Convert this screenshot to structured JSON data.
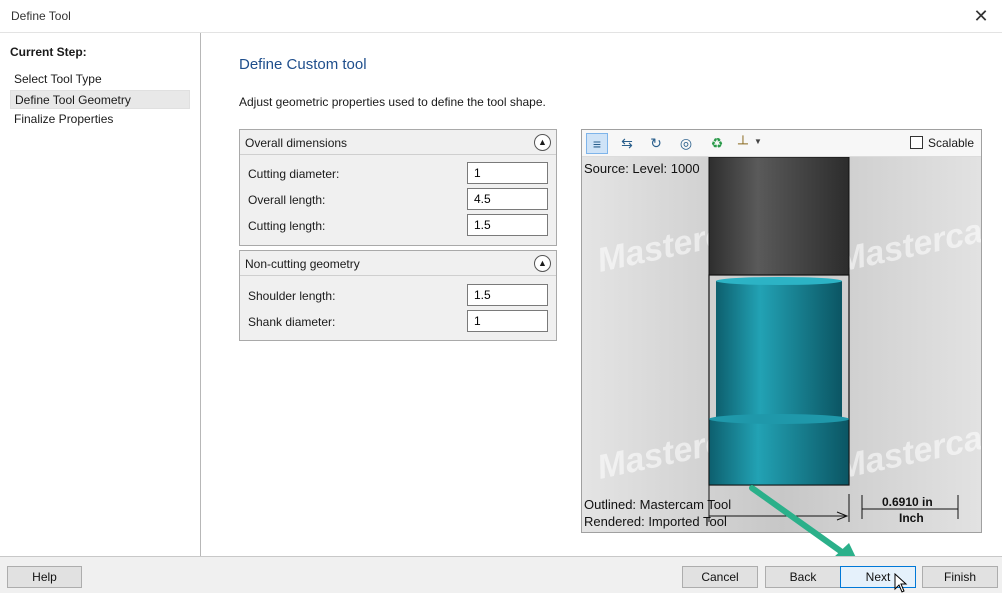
{
  "window": {
    "title": "Define Tool",
    "close_glyph": "✕"
  },
  "steps": {
    "heading": "Current Step:",
    "items": [
      {
        "label": "Select Tool Type",
        "active": false
      },
      {
        "label": "Define Tool Geometry",
        "active": true
      },
      {
        "label": "Finalize Properties",
        "active": false
      }
    ]
  },
  "main": {
    "title": "Define Custom tool",
    "description": "Adjust geometric properties used to define the tool shape."
  },
  "overall": {
    "title": "Overall dimensions",
    "fields": [
      {
        "label": "Cutting diameter:",
        "value": "1"
      },
      {
        "label": "Overall length:",
        "value": "4.5"
      },
      {
        "label": "Cutting length:",
        "value": "1.5"
      }
    ]
  },
  "noncutting": {
    "title": "Non-cutting geometry",
    "fields": [
      {
        "label": "Shoulder length:",
        "value": "1.5"
      },
      {
        "label": "Shank diameter:",
        "value": "1"
      }
    ]
  },
  "preview": {
    "toolbar_icons": [
      "fit-view-icon",
      "rotate-view-icon",
      "refresh-view-icon",
      "display-options-icon",
      "recycle-icon",
      "tool-holder-icon"
    ],
    "scalable_label": "Scalable",
    "scalable_checked": false,
    "source_text": "Source: Level: 1000",
    "watermark": "Mastercam",
    "outlined_text": "Outlined: Mastercam Tool",
    "rendered_text": "Rendered: Imported Tool",
    "dim_value": "0.6910 in",
    "dim_unit": "Inch"
  },
  "buttons": {
    "help": "Help",
    "cancel": "Cancel",
    "back": "Back",
    "next": "Next",
    "finish": "Finish"
  },
  "colors": {
    "holder": "#444444",
    "cutter": "#1a8a9c",
    "annotation_arrow": "#2bb08a",
    "title_accent": "#1e4e8c"
  }
}
